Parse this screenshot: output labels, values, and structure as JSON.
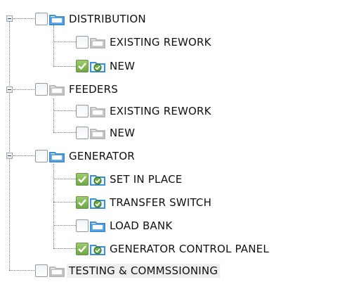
{
  "colors": {
    "folder_blue": "#3d8fd6",
    "folder_gray": "#b9b9b9",
    "check_green": "#6ea843"
  },
  "tree": [
    {
      "label": "DISTRIBUTION",
      "expanded": true,
      "checked": false,
      "folder": "blue",
      "children": [
        {
          "label": "EXISTING REWORK",
          "checked": false,
          "folder": "gray"
        },
        {
          "label": "NEW",
          "checked": true,
          "folder": "checked"
        }
      ]
    },
    {
      "label": "FEEDERS",
      "expanded": true,
      "checked": false,
      "folder": "gray",
      "children": [
        {
          "label": "EXISTING REWORK",
          "checked": false,
          "folder": "gray"
        },
        {
          "label": "NEW",
          "checked": false,
          "folder": "gray"
        }
      ]
    },
    {
      "label": "GENERATOR",
      "expanded": true,
      "checked": false,
      "folder": "blue",
      "children": [
        {
          "label": "SET IN PLACE",
          "checked": true,
          "folder": "checked"
        },
        {
          "label": "TRANSFER SWITCH",
          "checked": true,
          "folder": "checked"
        },
        {
          "label": "LOAD BANK",
          "checked": false,
          "folder": "blue"
        },
        {
          "label": "GENERATOR CONTROL PANEL",
          "checked": true,
          "folder": "checked"
        }
      ]
    },
    {
      "label": "TESTING & COMMSSIONING",
      "expanded": false,
      "checked": false,
      "folder": "gray",
      "selected": true,
      "children": []
    }
  ]
}
